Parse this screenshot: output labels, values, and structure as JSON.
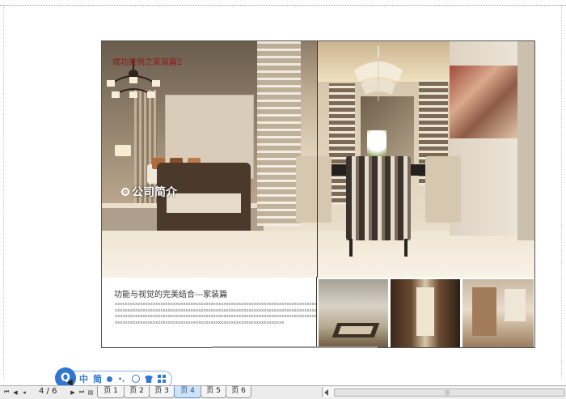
{
  "document": {
    "hero_title": "成功案例之家装篇2",
    "hero_subtitle": "公司简介",
    "caption": "功能与视觉的完美结合---家装篇",
    "body_text": "xxxxxxxxxxxxxxxxxxxxxxxxxxxxxxxxxxxxxxxxxxxxxxxxxxxxxxxxxxxxxxxxxxxxxxxxxxxxxxxxxxxxxxxxxxxxxxxxxxxxxxxxxxxxxxxxxxxxxxxxxxxxxxxxxxxxxxxxxxxxxxxxxxxxxxxxxxxxxxxxxxxxxxxxxxxxxxxxxxxxxxxxxxxxxxxxxxxxxxxxxxxxxxxxxxxxxxxxxxxxxxxxxxxxxxxxxxxxxxxxxxxxxxxxxxxxxxxxxxxxxxxxxxxxxxxxxxxxxxxxxxxxxxxxxxxxxxxxxxxxxxxxxxx"
  },
  "ime_toolbar": {
    "logo": "Q",
    "mode": "中",
    "charset": "简",
    "punct": "•,",
    "icons": [
      "dot-icon",
      "smile-icon",
      "shirt-icon",
      "grid-icon"
    ],
    "accent": "#2f77d1"
  },
  "statusbar": {
    "page_counter": "4 / 6",
    "tabs": [
      "页 1",
      "页 2",
      "页 3",
      "页 4",
      "页 5",
      "页 6"
    ],
    "active_tab": "页 4",
    "nav_icons": [
      "first-page-icon",
      "prev-page-icon",
      "next-page-icon",
      "last-page-icon",
      "insert-page-icon"
    ],
    "active_color": "#cfe2f7"
  }
}
